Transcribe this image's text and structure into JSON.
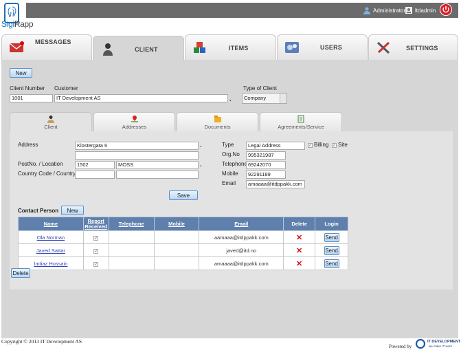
{
  "app": {
    "logo_text_1": "Sigi",
    "logo_text_2": "Rapp"
  },
  "topbar": {
    "user_name": "Administrator",
    "org_name": "ltdadmin"
  },
  "main_tabs": [
    {
      "label": "MESSAGES",
      "icon": "envelope-icon"
    },
    {
      "label": "CLIENT",
      "icon": "person-icon"
    },
    {
      "label": "ITEMS",
      "icon": "boxes-icon"
    },
    {
      "label": "USERS",
      "icon": "gears-icon"
    },
    {
      "label": "SETTINGS",
      "icon": "tools-icon"
    }
  ],
  "client": {
    "new_label": "New",
    "client_number_label": "Client Number",
    "customer_label": "Customer",
    "client_number_value": "1001",
    "customer_value": "IT Development AS",
    "type_label": "Type of Client",
    "type_value": "Company"
  },
  "sub_tabs": [
    {
      "label": "Client",
      "icon": "person-icon"
    },
    {
      "label": "Addresses",
      "icon": "map-pin-icon"
    },
    {
      "label": "Documents",
      "icon": "folder-icon"
    },
    {
      "label": "Agreements/Service",
      "icon": "document-icon"
    }
  ],
  "address": {
    "address_label": "Address",
    "address_value": "Klostergata 6",
    "address2_value": "",
    "postno_label": "PostNo. / Location",
    "postno_value": "1502",
    "location_value": "MOSS",
    "country_label": "Country Code / Country",
    "country_code_value": "",
    "country_value": ""
  },
  "details": {
    "type_label": "Type",
    "type_value": "Legal Address",
    "billing_label": "Billing",
    "site_label": "Site",
    "orgno_label": "Org.No",
    "orgno_value": "995321987",
    "telephone_label": "Telephone",
    "telephone_value": "69242070",
    "mobile_label": "Mobile",
    "mobile_value": "92291189",
    "email_label": "Email",
    "email_value": "amaaaa@itdppakk.com"
  },
  "save_label": "Save",
  "contact": {
    "title": "Contact Person",
    "new_label": "New",
    "columns": [
      "Name",
      "Report Received",
      "Telephone",
      "Mobile",
      "Email",
      "Delete",
      "Login"
    ],
    "rows": [
      {
        "name": "Ola Norman",
        "telephone": "",
        "mobile": "",
        "email": "aamaaa@itdppakk.com",
        "login": "Send"
      },
      {
        "name": "Javed Sattar",
        "telephone": "",
        "mobile": "",
        "email": "javed@itd.no",
        "login": "Send"
      },
      {
        "name": "Imtiaz Hussain",
        "telephone": "",
        "mobile": "",
        "email": "amaaaa@itdppakk.com",
        "login": "Send"
      }
    ],
    "delete_label": "Delete"
  },
  "footer": {
    "copyright": "Copyright © 2013 IT Development AS",
    "powered_by": "Powered by",
    "brand": "IT DEVELOPMENT",
    "tagline": "we make IT work"
  },
  "colors": {
    "accent": "#5f80ac",
    "topbar": "#6b6b6b",
    "panel": "#d6d6d6",
    "required": "#dd0000"
  }
}
